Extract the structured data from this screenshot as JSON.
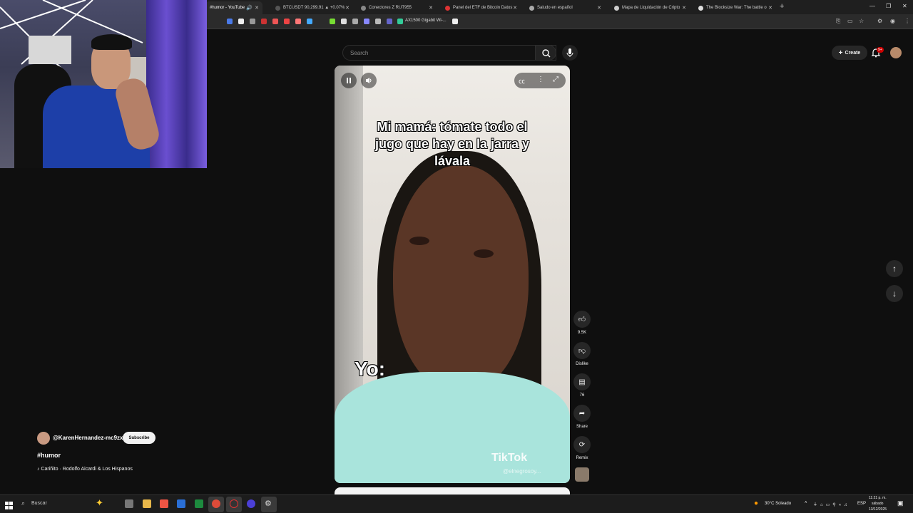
{
  "browser": {
    "tabs": [
      {
        "title": "#humor - YouTube",
        "active": true
      },
      {
        "title": "BTCUSDT 90,299.91 ▲ +0.07%"
      },
      {
        "title": "Conectores Z RUT955"
      },
      {
        "title": "Panel del ETF de Bitcoin Datos"
      },
      {
        "title": "Saludo en español"
      },
      {
        "title": "Mapa de Liquidación de Cripto"
      },
      {
        "title": "The Blocksize War: The battle o"
      }
    ],
    "bookmark_label": "AX1500 Gigabit Wi-..."
  },
  "header": {
    "search_placeholder": "Search",
    "create_label": "Create",
    "notifications_badge": "9+"
  },
  "video": {
    "caption_top": "Mi mamá: tómate todo el jugo que hay en la jarra y lávala",
    "caption_bottom": "Yo:",
    "watermark": "TikTok",
    "watermark_handle": "@elnegrosoy..."
  },
  "actions": {
    "likes": "9.5K",
    "dislike_label": "Dislike",
    "comments": "76",
    "share_label": "Share",
    "remix_label": "Remix"
  },
  "channel": {
    "handle": "@KarenHernandez-mc9zx",
    "subscribe_label": "Subscribe",
    "title": "#humor",
    "sound": "♪ Cariñito · Rodolfo Aicardi & Los Hispanos"
  },
  "taskbar": {
    "search_label": "Buscar",
    "weather": "30°C  Soleado",
    "lang": "ESP",
    "time": "11:21 p. m.",
    "day": "sábado",
    "date": "13/12/2025"
  },
  "colors": {
    "background": "#0f0f0f",
    "accent_red": "#cc0000",
    "shirt": "#a9e4dc"
  }
}
